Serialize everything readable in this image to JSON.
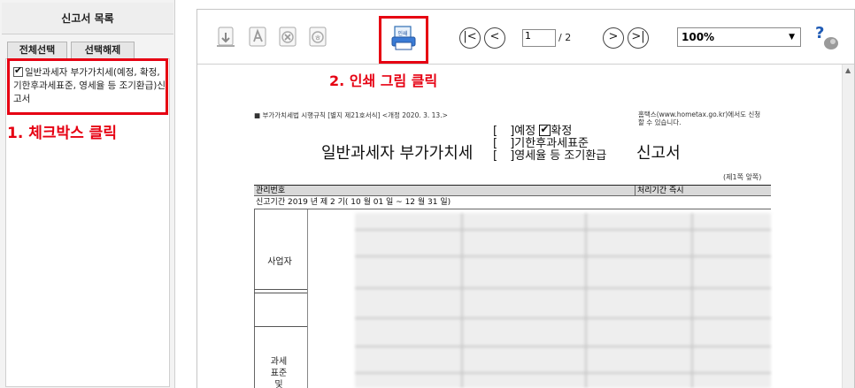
{
  "left_panel": {
    "header": "신고서 목록",
    "select_all_label": "전체선택",
    "deselect_all_label": "선택해제",
    "items": [
      {
        "label": "일반과세자 부가가치세(예정, 확정, 기한후과세표준, 영세율 등 조기환급)신고서",
        "checked": true
      }
    ]
  },
  "annotations": {
    "step1": "1. 체크박스 클릭",
    "step2": "2. 인쇄 그림 클릭",
    "color": "#e60012"
  },
  "toolbar": {
    "icons": [
      "save-icon",
      "pdf-icon",
      "excel-icon",
      "hwp-icon",
      "print-icon"
    ],
    "print_label": "인쇄",
    "page_current": "1",
    "page_total": "/ 2",
    "zoom": "100%"
  },
  "document": {
    "law_reference": "■ 부가가치세법 시행규칙 [별지 제21호서식] <개정 2020. 3. 13.>",
    "hometax_note": "홈택스(www.hometax.go.kr)에서도 신청할 수 있습니다.",
    "title": "일반과세자 부가가치세",
    "options": [
      "예정",
      "확정",
      "기한후과세표준",
      "영세율 등 조기환급"
    ],
    "checked_option": "확정",
    "title_suffix": "신고서",
    "page_count": "(제1쪽 앞쪽)",
    "management_no_label": "관리번호",
    "processing_period_label": "처리기간 즉시",
    "filing_period": "신고기간 2019 년 제 2 기( 10 월 01 일 ~ 12 월 31 일)",
    "business_label": "사업자",
    "tax_base_label": "과세 표준 및"
  }
}
